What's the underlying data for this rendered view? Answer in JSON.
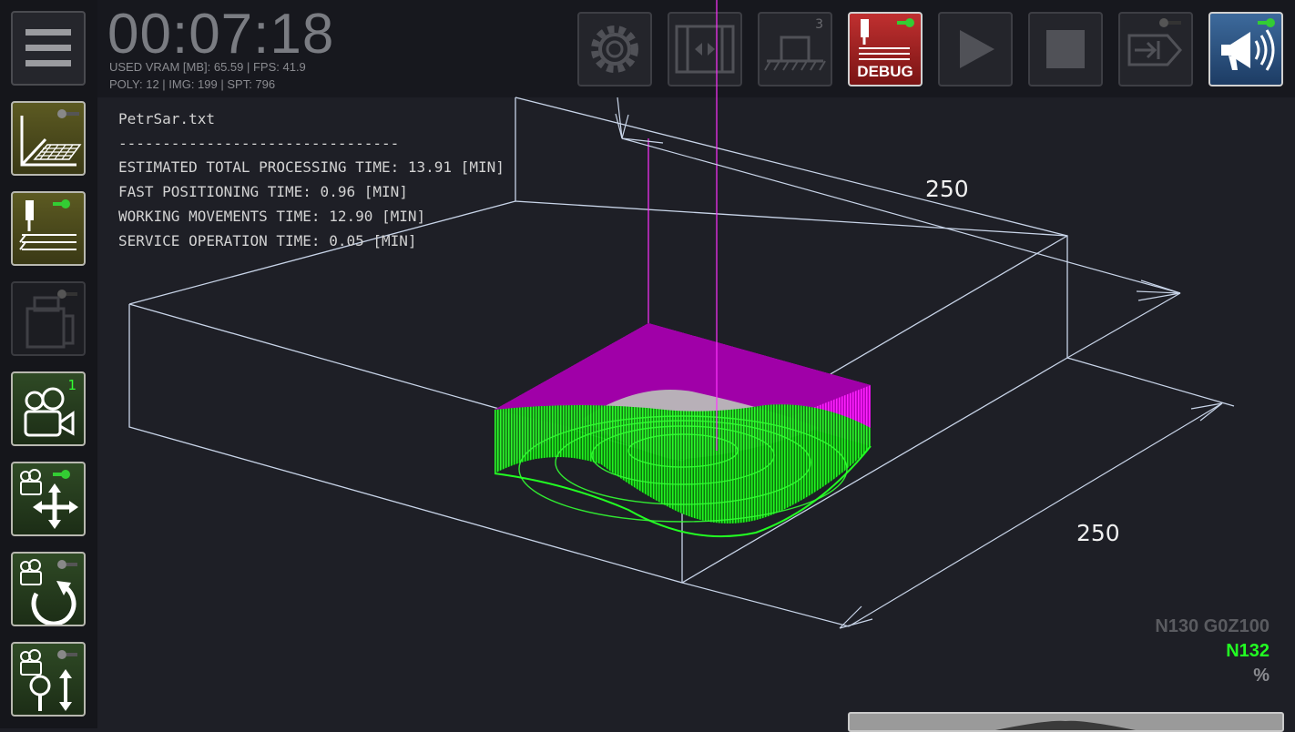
{
  "status": {
    "timer": "00:07:18",
    "line1": "USED VRAM [MB]: 65.59 | FPS: 41.9",
    "line2": "POLY: 12 | IMG: 199 | SPT: 796"
  },
  "info": {
    "filename": "PetrSar.txt",
    "separator": "--------------------------------",
    "total": "ESTIMATED TOTAL PROCESSING TIME: 13.91 [MIN]",
    "fast": "FAST POSITIONING TIME: 0.96 [MIN]",
    "working": "WORKING MOVEMENTS TIME: 12.90 [MIN]",
    "service": "SERVICE OPERATION TIME: 0.05 [MIN]"
  },
  "toolbar": {
    "debug_label": "DEBUG",
    "machine_badge": "3"
  },
  "sidebar": {
    "camera_badge": "1"
  },
  "dimensions": {
    "width": "250",
    "depth": "250"
  },
  "gcode": {
    "previous": "N130 G0Z100",
    "current": "N132",
    "next": "%"
  },
  "colors": {
    "magenta": "#ff00ff",
    "green": "#22ff22",
    "led_green": "#33cc33"
  }
}
